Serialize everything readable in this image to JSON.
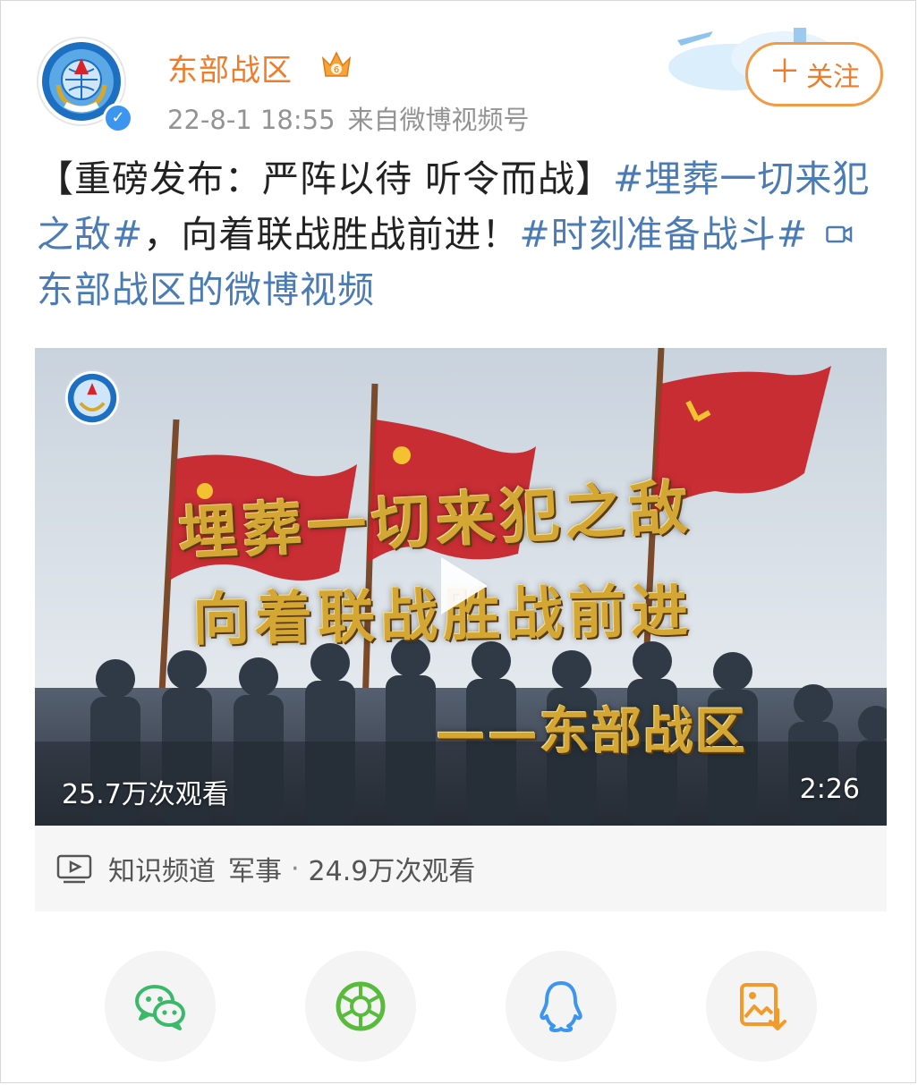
{
  "header": {
    "username": "东部战区",
    "timestamp": "22-8-1 18:55",
    "source": "来自微博视频号",
    "follow_label": "关注",
    "follow_plus": "＋",
    "verified_mark": "✓",
    "crown_level": "6"
  },
  "post": {
    "bracket_text": "【重磅发布：严阵以待  听令而战】",
    "tag1": "#埋葬一切来犯之敌#",
    "middle_text": "，向着联战胜战前进！",
    "tag2": "#时刻准备战斗#",
    "video_link": "东部战区的微博视频"
  },
  "video": {
    "calligraphy_line1": "埋葬一切来犯之敌",
    "calligraphy_line2": "向着联战胜战前进",
    "calligraphy_line3": "——东部战区",
    "views_overlay": "25.7万次观看",
    "duration": "2:26"
  },
  "channel": {
    "name": "知识频道",
    "category": "军事",
    "dot": "·",
    "views": "24.9万次观看"
  },
  "share": [
    {
      "icon": "wechat-icon",
      "color": "#3bb96b"
    },
    {
      "icon": "moments-icon",
      "color": "#58bb3c"
    },
    {
      "icon": "qq-icon",
      "color": "#3c95ef"
    },
    {
      "icon": "save-image-icon",
      "color": "#f29b2c"
    }
  ],
  "colors": {
    "username": "#f07b2a",
    "link": "#4a7bb5",
    "meta": "#939393",
    "follow_border": "#f29b44"
  }
}
